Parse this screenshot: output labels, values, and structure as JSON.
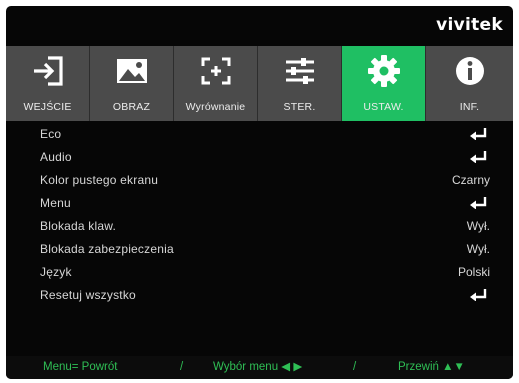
{
  "brand": "vivitek",
  "tabs": [
    {
      "label": "WEJŚCIE",
      "icon": "input-icon",
      "active": false
    },
    {
      "label": "OBRAZ",
      "icon": "image-icon",
      "active": false
    },
    {
      "label": "Wyrównanie",
      "icon": "alignment-icon",
      "active": false
    },
    {
      "label": "STER.",
      "icon": "sliders-icon",
      "active": false
    },
    {
      "label": "USTAW.",
      "icon": "gear-icon",
      "active": true
    },
    {
      "label": "INF.",
      "icon": "info-icon",
      "active": false
    }
  ],
  "menu": [
    {
      "label": "Eco",
      "value": null,
      "enter": true
    },
    {
      "label": "Audio",
      "value": null,
      "enter": true
    },
    {
      "label": "Kolor pustego ekranu",
      "value": "Czarny",
      "enter": false
    },
    {
      "label": "Menu",
      "value": null,
      "enter": true
    },
    {
      "label": "Blokada klaw.",
      "value": "Wył.",
      "enter": false
    },
    {
      "label": "Blokada zabezpieczenia",
      "value": "Wył.",
      "enter": false
    },
    {
      "label": "Język",
      "value": "Polski",
      "enter": false
    },
    {
      "label": "Resetuj wszystko",
      "value": null,
      "enter": true
    }
  ],
  "footer": {
    "back": "Menu= Powrót",
    "sep1": "/",
    "select": "Wybór menu ◀ ▶",
    "sep2": "/",
    "scroll": "Przewiń ▲▼"
  },
  "colors": {
    "accent": "#1fbf63",
    "tab_bg": "#4b4b4b",
    "footer_text": "#2fbf55"
  }
}
